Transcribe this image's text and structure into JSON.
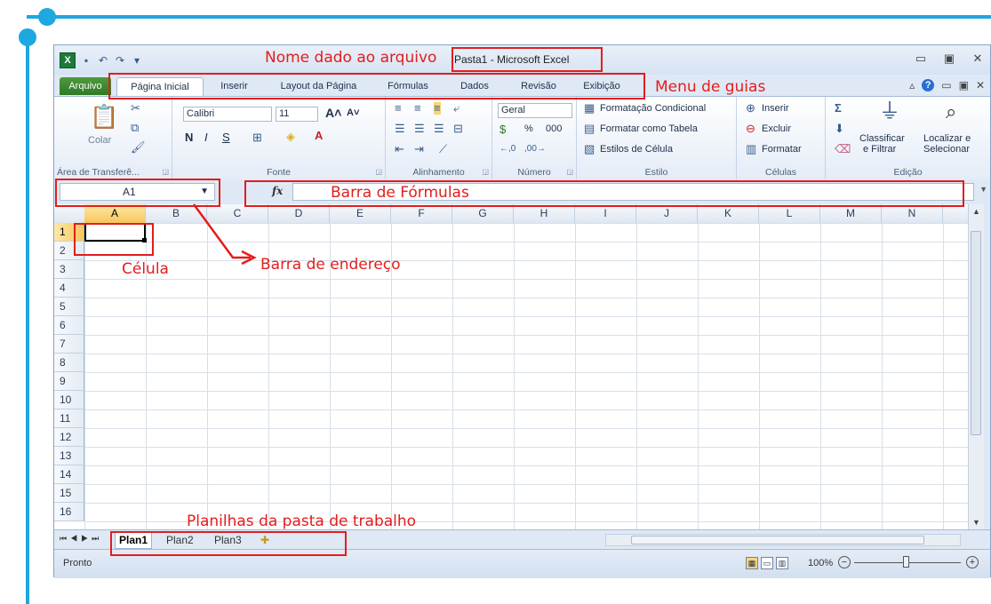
{
  "annotations": {
    "filename": "Nome dado ao arquivo",
    "tabs_menu": "Menu de guias",
    "formula_bar": "Barra de Fórmulas",
    "cell": "Célula",
    "address_bar": "Barra de endereço",
    "sheets": "Planilhas da pasta de trabalho"
  },
  "window": {
    "title": "Pasta1 - Microsoft Excel"
  },
  "tabs": {
    "file": "Arquivo",
    "items": [
      "Página Inicial",
      "Inserir",
      "Layout da Página",
      "Fórmulas",
      "Dados",
      "Revisão",
      "Exibição"
    ]
  },
  "ribbon": {
    "clipboard": {
      "paste": "Colar",
      "label": "Área de Transferê..."
    },
    "font": {
      "name": "Calibri",
      "size": "11",
      "bold": "N",
      "italic": "I",
      "underline": "S",
      "label": "Fonte"
    },
    "alignment": {
      "label": "Alinhamento"
    },
    "number": {
      "format": "Geral",
      "percent": "%",
      "thousands": "000",
      "label": "Número"
    },
    "styles": {
      "conditional": "Formatação Condicional",
      "table": "Formatar como Tabela",
      "cell_styles": "Estilos de Célula",
      "label": "Estilo"
    },
    "cells": {
      "insert": "Inserir",
      "delete": "Excluir",
      "format": "Formatar",
      "label": "Células"
    },
    "editing": {
      "sort1": "Classificar",
      "sort2": "e Filtrar",
      "find1": "Localizar e",
      "find2": "Selecionar",
      "label": "Edição"
    }
  },
  "formula_bar": {
    "name_box": "A1",
    "fx": "fx",
    "value": ""
  },
  "grid": {
    "columns": [
      "A",
      "B",
      "C",
      "D",
      "E",
      "F",
      "G",
      "H",
      "I",
      "J",
      "K",
      "L",
      "M",
      "N"
    ],
    "rows": [
      "1",
      "2",
      "3",
      "4",
      "5",
      "6",
      "7",
      "8",
      "9",
      "10",
      "11",
      "12",
      "13",
      "14",
      "15",
      "16"
    ],
    "active_cell": "A1"
  },
  "sheets": {
    "tabs": [
      "Plan1",
      "Plan2",
      "Plan3"
    ],
    "active": "Plan1"
  },
  "status": {
    "text": "Pronto",
    "zoom": "100%"
  },
  "colors": {
    "accent": "#1fa7df",
    "annotation_red": "#e31d1d",
    "file_tab_green": "#2f7a25"
  }
}
